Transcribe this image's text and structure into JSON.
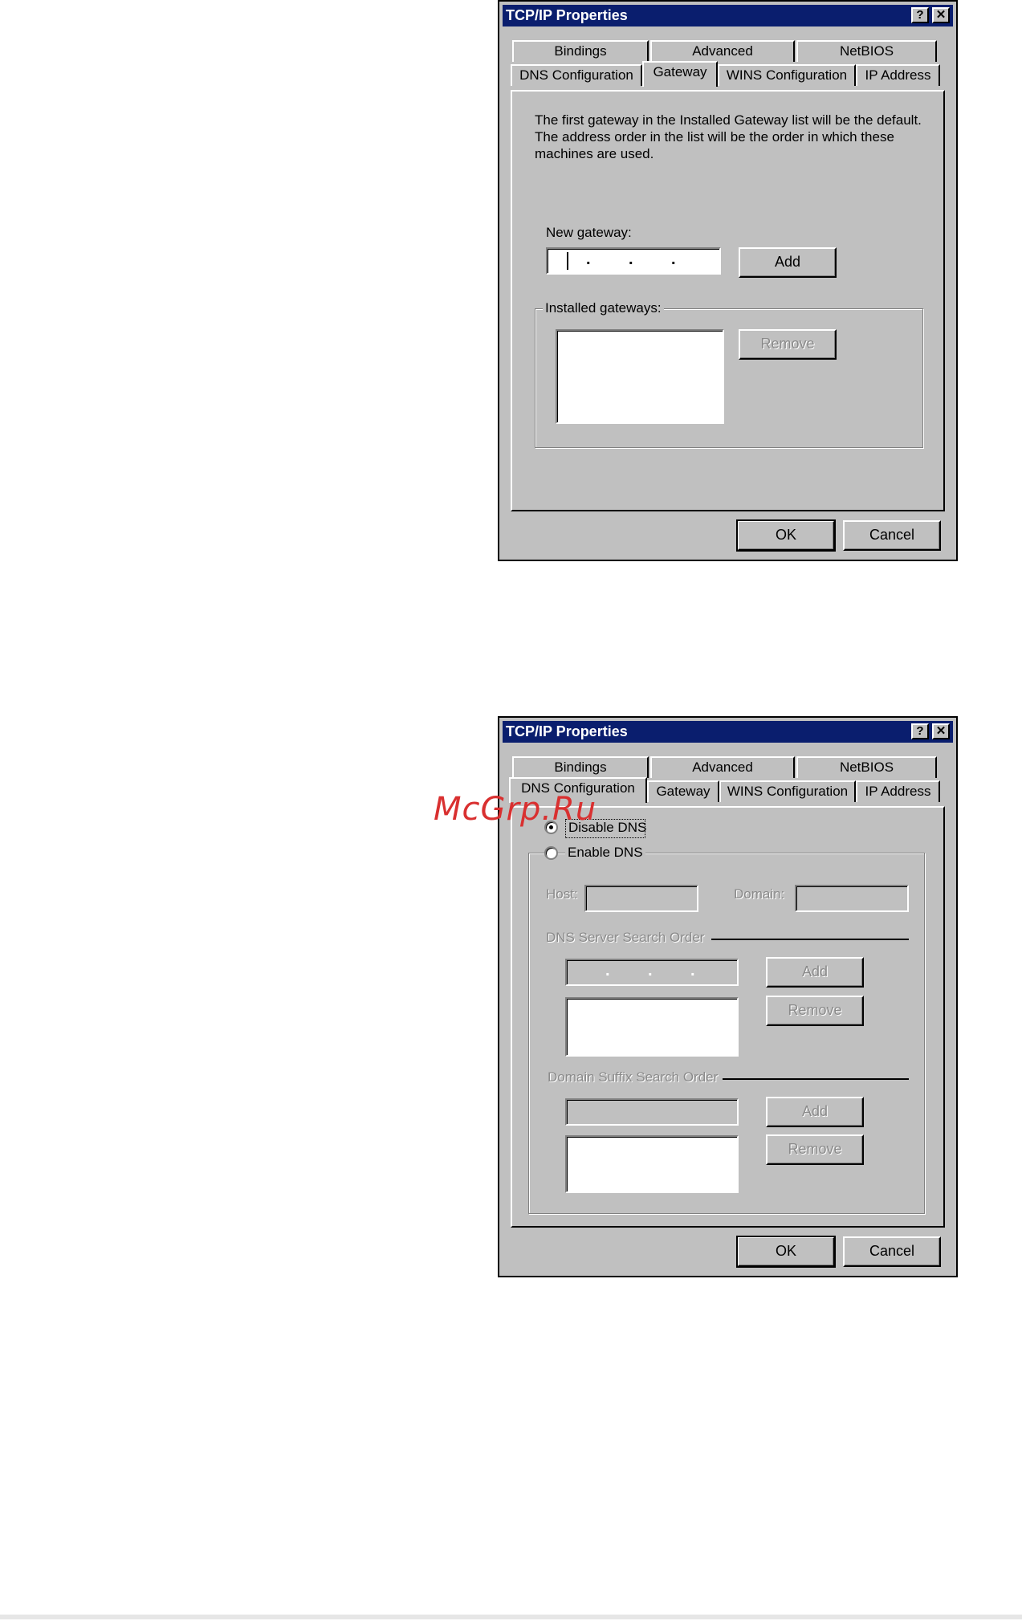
{
  "gateway_dialog": {
    "title": "TCP/IP Properties",
    "help_button": "?",
    "close_button": "✕",
    "tabs_back": [
      "Bindings",
      "Advanced",
      "NetBIOS"
    ],
    "tabs_front": [
      "DNS Configuration",
      "Gateway",
      "WINS Configuration",
      "IP Address"
    ],
    "active_tab": "Gateway",
    "info_text": "The first gateway in the Installed Gateway list will be the default. The address order in the list will be the order in which these machines are used.",
    "new_gateway_label": "New gateway:",
    "new_gateway_value": ".   .   .",
    "add_button": "Add",
    "installed_gateways_label": "Installed gateways:",
    "remove_button": "Remove",
    "ok_button": "OK",
    "cancel_button": "Cancel"
  },
  "dns_dialog": {
    "title": "TCP/IP Properties",
    "help_button": "?",
    "close_button": "✕",
    "tabs_back": [
      "Bindings",
      "Advanced",
      "NetBIOS"
    ],
    "tabs_front": [
      "DNS Configuration",
      "Gateway",
      "WINS Configuration",
      "IP Address"
    ],
    "active_tab": "DNS Configuration",
    "disable_dns_label": "Disable DNS",
    "enable_dns_label": "Enable DNS",
    "selected_option": "Disable DNS",
    "host_label": "Host:",
    "domain_label": "Domain:",
    "dns_server_search_order_label": "DNS Server Search Order",
    "dns_add_button": "Add",
    "dns_remove_button": "Remove",
    "domain_suffix_search_order_label": "Domain Suffix Search Order",
    "suffix_add_button": "Add",
    "suffix_remove_button": "Remove",
    "ok_button": "OK",
    "cancel_button": "Cancel"
  },
  "watermark": "McGrp.Ru",
  "colors": {
    "titlebar": "#0a1e6e",
    "face": "#c0c0c0",
    "watermark": "#d93030"
  }
}
